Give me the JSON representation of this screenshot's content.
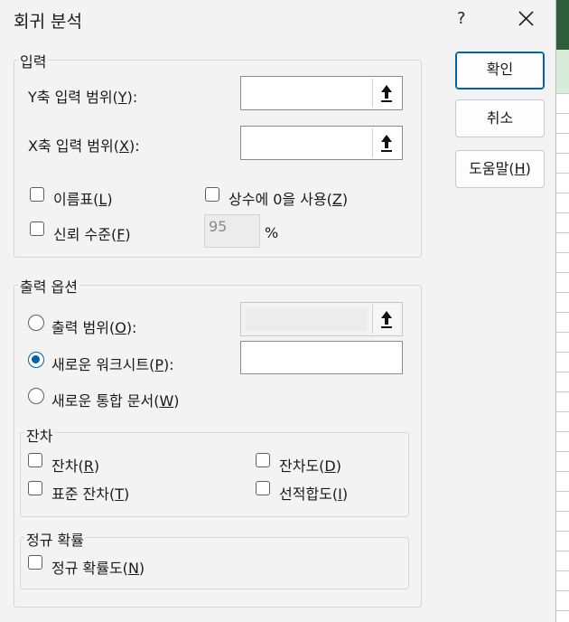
{
  "window": {
    "title": "회귀 분석",
    "help": "?"
  },
  "input_group": {
    "label": "입력",
    "y_range": {
      "label_pre": "Y축 입력 범위(",
      "accel": "Y",
      "label_post": "):",
      "value": ""
    },
    "x_range": {
      "label_pre": "X축 입력 범위(",
      "accel": "X",
      "label_post": "):",
      "value": ""
    },
    "labels_cb": {
      "label_pre": "이름표(",
      "accel": "L",
      "label_post": ")",
      "checked": false
    },
    "const_zero_cb": {
      "label_pre": "상수에 0을 사용(",
      "accel": "Z",
      "label_post": ")",
      "checked": false
    },
    "confidence_cb": {
      "label_pre": "신뢰 수준(",
      "accel": "F",
      "label_post": ")",
      "checked": false
    },
    "confidence_value": "95",
    "percent": "%"
  },
  "output_group": {
    "label": "출력 옵션",
    "output_range": {
      "label_pre": "출력 범위(",
      "accel": "O",
      "label_post": "):",
      "selected": false
    },
    "new_sheet": {
      "label_pre": "새로운 워크시트(",
      "accel": "P",
      "label_post": "):",
      "selected": true,
      "value": ""
    },
    "new_workbook": {
      "label_pre": "새로운 통합 문서(",
      "accel": "W",
      "label_post": ")",
      "selected": false
    }
  },
  "residuals_group": {
    "label": "잔차",
    "residuals": {
      "label_pre": "잔차(",
      "accel": "R",
      "label_post": ")",
      "checked": false
    },
    "residual_plots": {
      "label_pre": "잔차도(",
      "accel": "D",
      "label_post": ")",
      "checked": false
    },
    "standardized": {
      "label_pre": "표준 잔차(",
      "accel": "T",
      "label_post": ")",
      "checked": false
    },
    "line_fit": {
      "label_pre": "선적합도(",
      "accel": "I",
      "label_post": ")",
      "checked": false
    }
  },
  "normal_group": {
    "label": "정규 확률",
    "normal_plots": {
      "label_pre": "정규 확률도(",
      "accel": "N",
      "label_post": ")",
      "checked": false
    }
  },
  "buttons": {
    "ok": "확인",
    "cancel": "취소",
    "help_pre": "도움말(",
    "help_accel": "H",
    "help_post": ")"
  },
  "colors": {
    "accent": "#0063b1",
    "dialog_bg": "#f3f3f3",
    "sheet_header": "#2f5e3a"
  }
}
